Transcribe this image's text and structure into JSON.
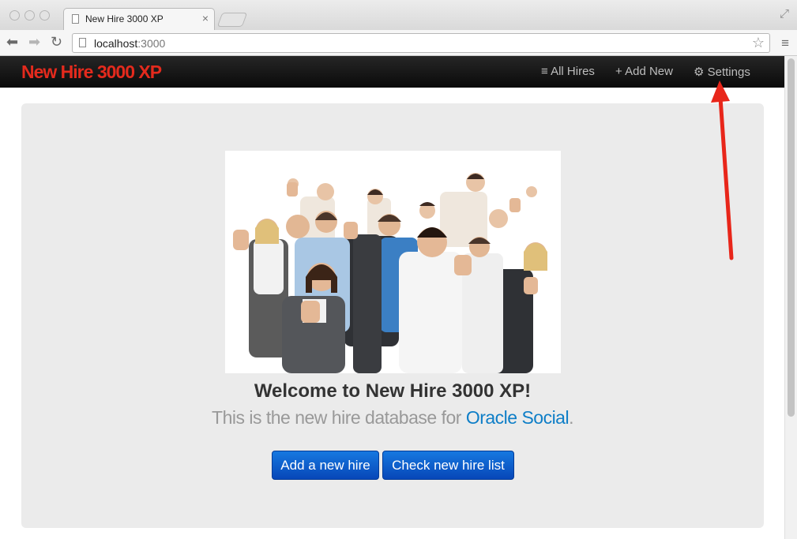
{
  "browser": {
    "tab_title": "New Hire 3000 XP",
    "tab_close": "×",
    "url_host": "localhost",
    "url_port": ":3000",
    "back_glyph": "⬅",
    "forward_glyph": "➡",
    "reload_glyph": "↻",
    "star_glyph": "☆",
    "menu_glyph": "≡",
    "fullscreen_glyph": "⤢"
  },
  "navbar": {
    "brand": "New Hire 3000 XP",
    "links": [
      {
        "label": "≡ All Hires"
      },
      {
        "label": "+ Add New"
      },
      {
        "label": "⚙ Settings"
      }
    ]
  },
  "hero": {
    "heading": "Welcome to New Hire 3000 XP!",
    "subtext_before": "This is the new hire database for ",
    "subtext_link": "Oracle Social",
    "subtext_after": ".",
    "buttons": [
      {
        "label": "Add a new hire"
      },
      {
        "label": "Check new hire list"
      }
    ]
  },
  "colors": {
    "brand": "#e42a1d",
    "link": "#0e7ec7",
    "button": "#0a5fd0",
    "arrow": "#e8261a"
  },
  "icons": {
    "tab_page": "page-icon",
    "photo": "team-thumbs-up-photo",
    "annotation": "red-arrow-pointing-to-settings"
  }
}
